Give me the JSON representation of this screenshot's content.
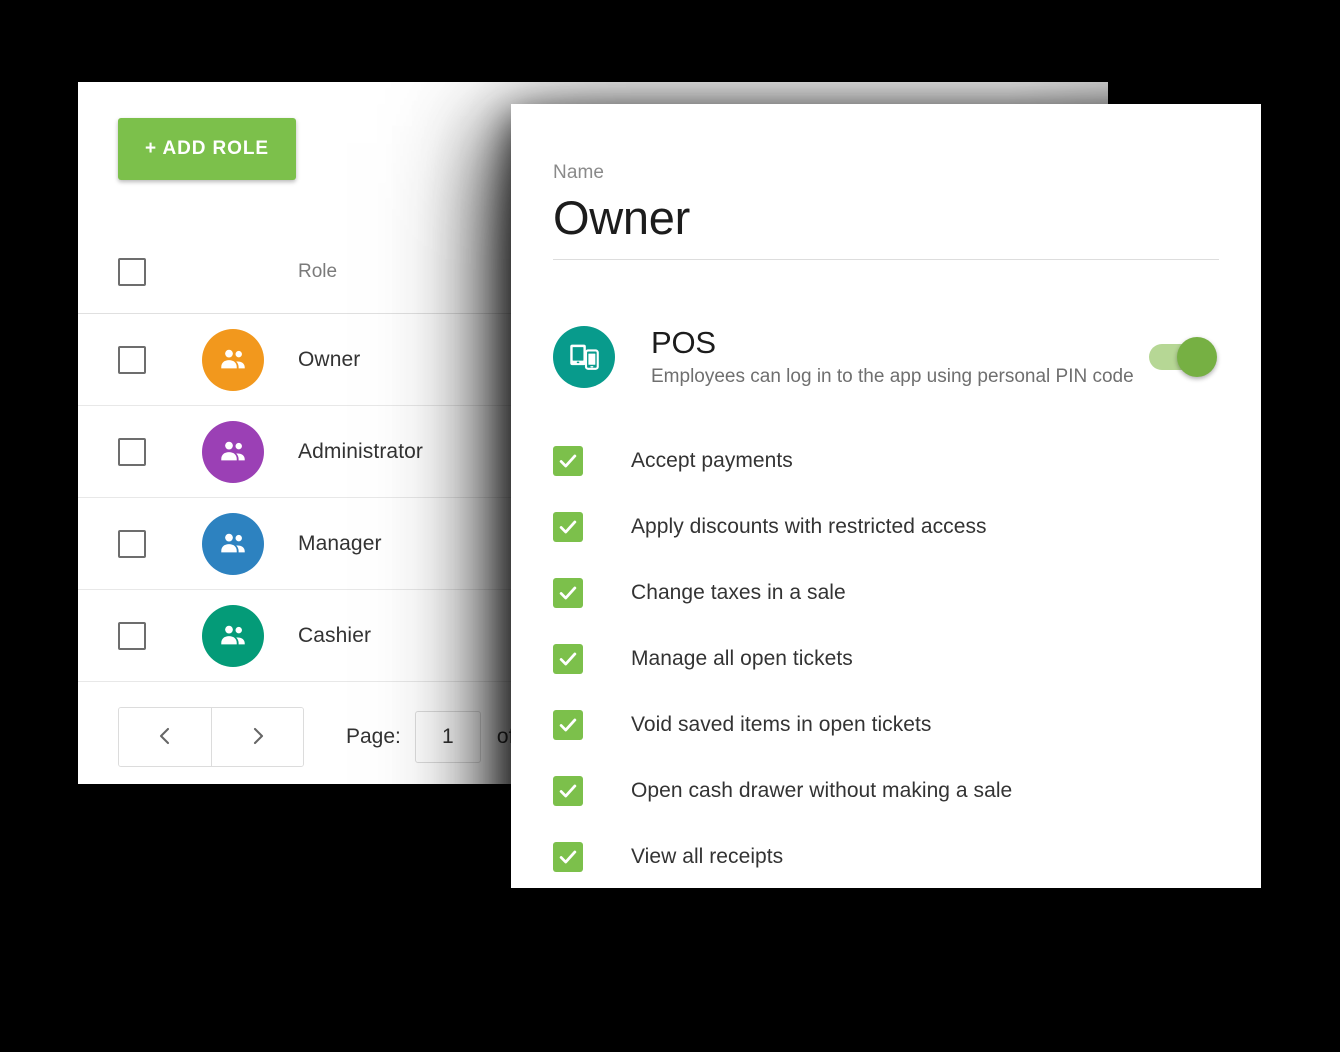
{
  "roles_panel": {
    "add_role_button": "+ ADD ROLE",
    "table": {
      "header": {
        "role_column": "Role"
      },
      "rows": [
        {
          "name": "Owner",
          "color": "#f2981d",
          "icon": "people-icon"
        },
        {
          "name": "Administrator",
          "color": "#9b40b5",
          "icon": "people-icon"
        },
        {
          "name": "Manager",
          "color": "#2d82c0",
          "icon": "people-icon"
        },
        {
          "name": "Cashier",
          "color": "#049b78",
          "icon": "people-icon"
        }
      ]
    },
    "pagination": {
      "prev_icon": "chevron-left-icon",
      "next_icon": "chevron-right-icon",
      "page_label": "Page:",
      "page_value": "1",
      "of_label": "of"
    }
  },
  "role_dialog": {
    "name_field": {
      "label": "Name",
      "value": "Owner"
    },
    "pos_section": {
      "icon": "devices-icon",
      "icon_color": "#089b8c",
      "title": "POS",
      "description": "Employees can log in to the app using personal PIN code",
      "toggle": {
        "state": "on",
        "track_color": "#b6d795",
        "thumb_color": "#76b043"
      }
    },
    "permissions": [
      {
        "label": "Accept payments",
        "checked": true
      },
      {
        "label": "Apply discounts with restricted access",
        "checked": true
      },
      {
        "label": "Change taxes in a sale",
        "checked": true
      },
      {
        "label": "Manage all open tickets",
        "checked": true
      },
      {
        "label": "Void saved items in open tickets",
        "checked": true
      },
      {
        "label": "Open cash drawer without making a sale",
        "checked": true
      },
      {
        "label": "View all receipts",
        "checked": true
      }
    ]
  },
  "theme": {
    "accent_green": "#7cc04b",
    "text_primary": "#333333",
    "text_secondary": "#7a7a7a"
  }
}
